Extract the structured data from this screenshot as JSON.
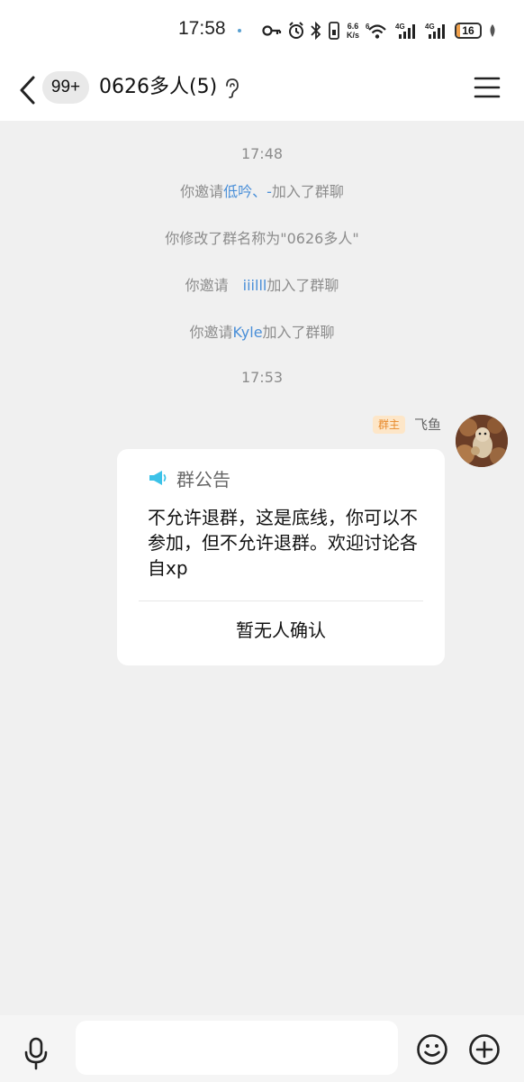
{
  "status_bar": {
    "time": "17:58",
    "net_speed_value": "6.6",
    "net_speed_unit": "K/s",
    "wifi_badge": "6",
    "signal1": "4G",
    "signal2": "4G",
    "battery": "16",
    "battery_level": 0.16,
    "icons": [
      "key-icon",
      "alarm-icon",
      "bluetooth-icon",
      "vibrate-icon",
      "wifi-icon",
      "signal-icon",
      "signal-icon",
      "battery-icon",
      "leaf-icon"
    ]
  },
  "header": {
    "unread_count": "99+",
    "title": "0626多人(5)",
    "icons": [
      "back-icon",
      "ear-icon",
      "menu-icon"
    ]
  },
  "messages": {
    "time1": "17:48",
    "event1": {
      "pre": "你邀请",
      "name": "低吟、-",
      "post": "加入了群聊"
    },
    "event2": "你修改了群名称为\"0626多人\"",
    "event3": {
      "pre": "你邀请",
      "name": "iiilll",
      "post": "加入了群聊"
    },
    "event4": {
      "pre": "你邀请",
      "name": "Kyle",
      "post": "加入了群聊"
    },
    "time2": "17:53"
  },
  "sender": {
    "role": "群主",
    "name": "飞鱼"
  },
  "announcement": {
    "title": "群公告",
    "body": "不允许退群，这是底线，你可以不参加，但不允许退群。欢迎讨论各自xp",
    "footer": "暂无人确认",
    "accent": "#3cc2e8"
  },
  "input": {
    "placeholder": "",
    "icons": [
      "microphone-icon",
      "emoji-icon",
      "plus-icon"
    ]
  }
}
